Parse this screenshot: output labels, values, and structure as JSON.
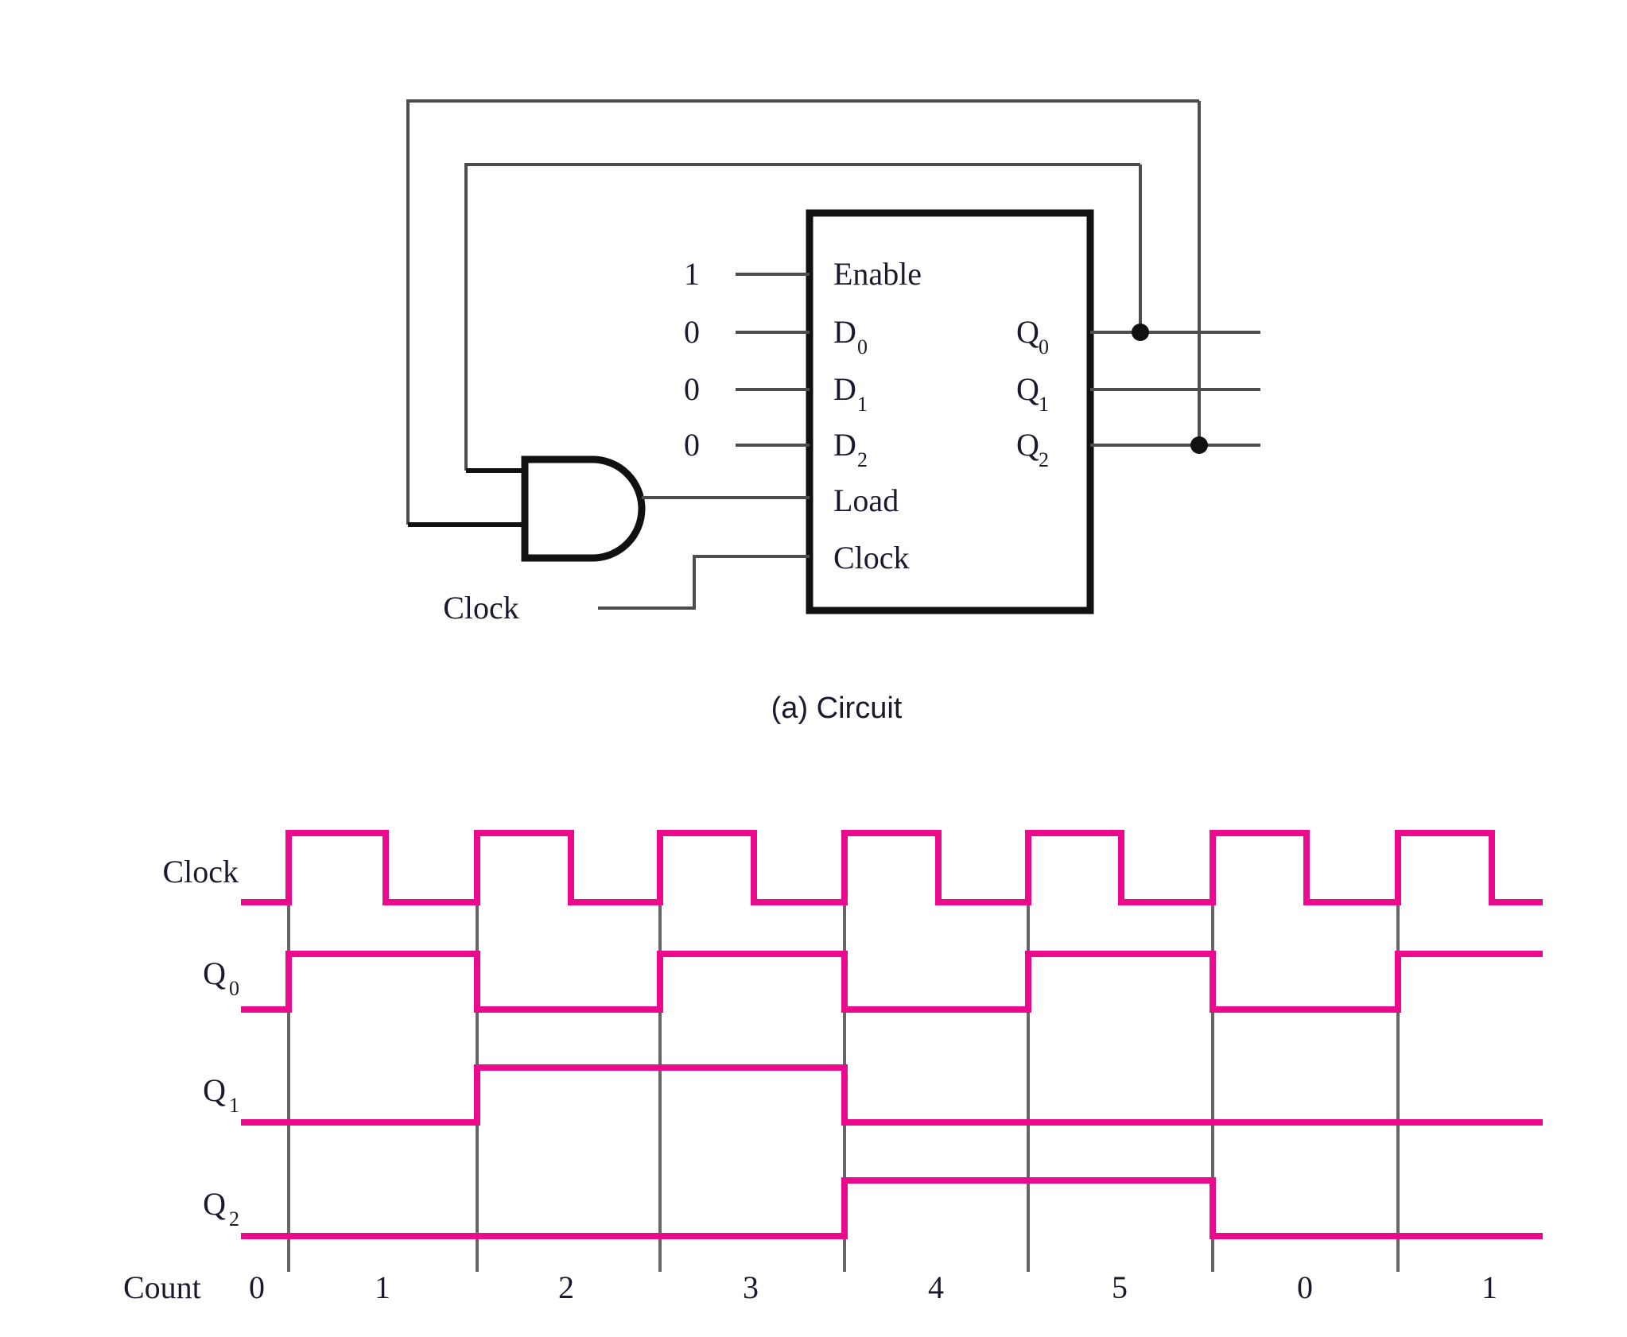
{
  "figure": {
    "caption_a": "(a) Circuit",
    "colors": {
      "waveform": "#EC0A8C",
      "wire": "#4d4d4d",
      "box_border": "#111111",
      "text": "#1a1a2e",
      "gridline": "#666666",
      "background": "#ffffff"
    }
  },
  "circuit": {
    "block_inputs": [
      {
        "label": "Enable",
        "value": "1"
      },
      {
        "label": "D",
        "sub": "0",
        "value": "0"
      },
      {
        "label": "D",
        "sub": "1",
        "value": "0"
      },
      {
        "label": "D",
        "sub": "2",
        "value": "0"
      }
    ],
    "block_controls": [
      {
        "label": "Load"
      },
      {
        "label": "Clock"
      }
    ],
    "block_outputs": [
      {
        "label": "Q",
        "sub": "0"
      },
      {
        "label": "Q",
        "sub": "1"
      },
      {
        "label": "Q",
        "sub": "2"
      }
    ],
    "external_clock_label": "Clock",
    "gate": {
      "type": "and-gate",
      "inputs": 2
    },
    "feedback_taps": [
      "Q0",
      "Q2"
    ]
  },
  "timing": {
    "row_labels": [
      "Clock",
      "Q₀",
      "Q₁",
      "Q₂"
    ],
    "rows": [
      {
        "name": "Clock",
        "base": "Clock",
        "sub": ""
      },
      {
        "name": "Q0",
        "base": "Q",
        "sub": "0"
      },
      {
        "name": "Q1",
        "base": "Q",
        "sub": "1"
      },
      {
        "name": "Q2",
        "base": "Q",
        "sub": "2"
      }
    ],
    "count_label": "Count",
    "count_values": [
      "0",
      "1",
      "2",
      "3",
      "4",
      "5",
      "0",
      "1"
    ]
  },
  "chart_data": {
    "type": "line",
    "title": "",
    "xlabel": "Count",
    "ylabel": "",
    "categories": [
      "0",
      "1",
      "2",
      "3",
      "4",
      "5",
      "0",
      "1"
    ],
    "series": [
      {
        "name": "Clock",
        "values": [
          0,
          0,
          0,
          0,
          0,
          0,
          0,
          0
        ],
        "note": "square wave, one full pulse per count interval, rising mid-interval"
      },
      {
        "name": "Q0",
        "values": [
          0,
          1,
          0,
          1,
          0,
          1,
          0,
          1
        ]
      },
      {
        "name": "Q1",
        "values": [
          0,
          0,
          1,
          1,
          0,
          0,
          0,
          0
        ]
      },
      {
        "name": "Q2",
        "values": [
          0,
          0,
          0,
          0,
          1,
          1,
          0,
          0
        ]
      }
    ],
    "grid": true,
    "legend": "left-row-labels"
  }
}
